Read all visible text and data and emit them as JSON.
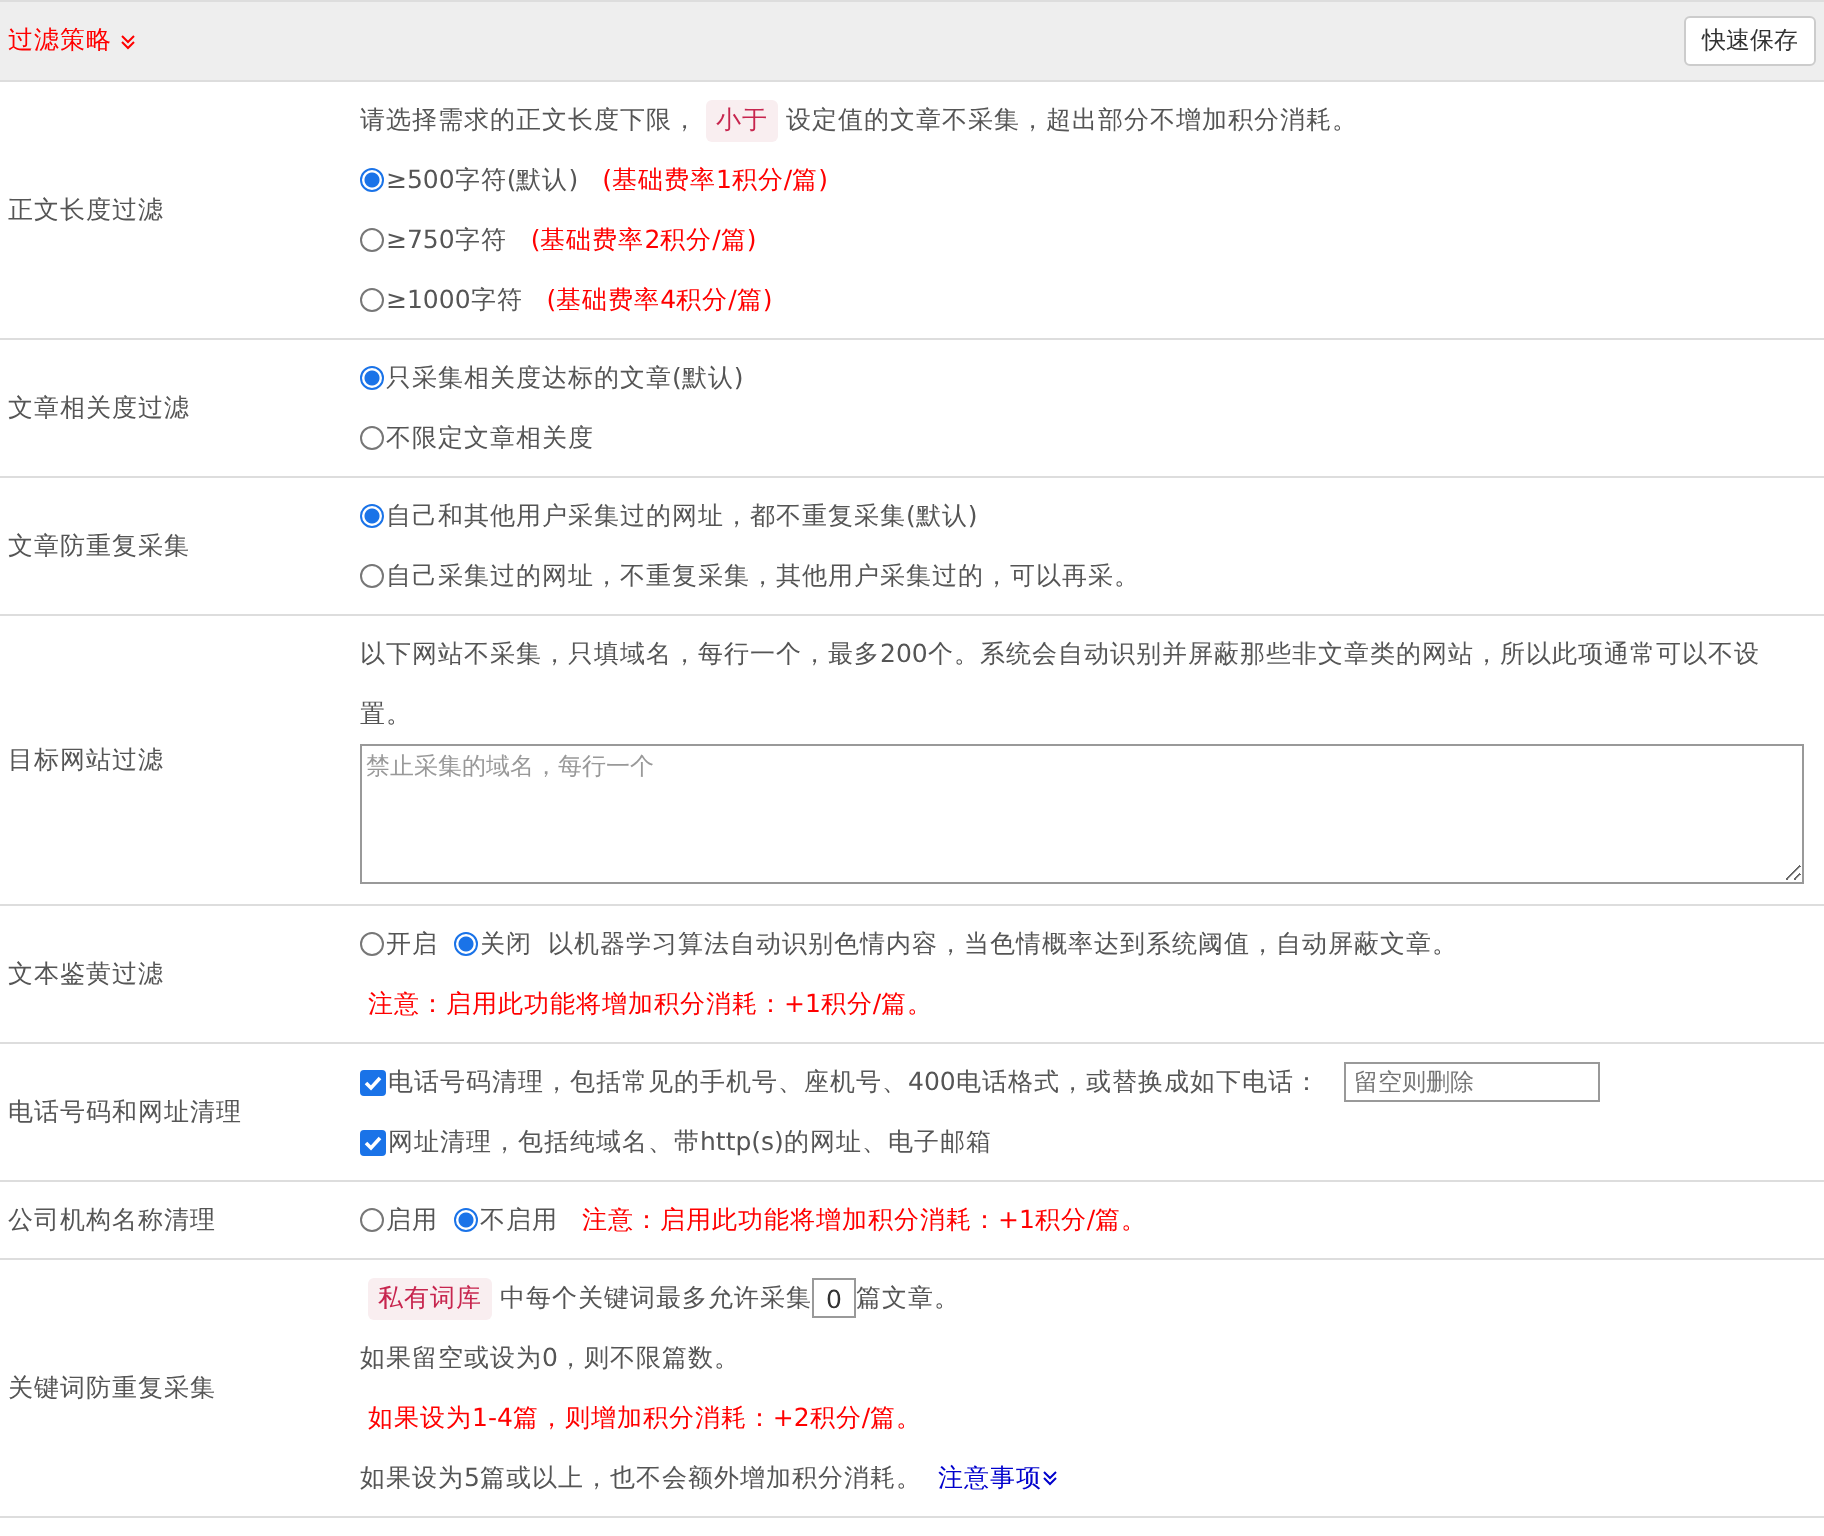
{
  "header": {
    "title": "过滤策略",
    "save_button": "快速保存"
  },
  "rows": [
    {
      "label": "正文长度过滤",
      "lines": [
        [
          {
            "kind": "text",
            "text": "请选择需求的正文长度下限，"
          },
          {
            "kind": "tag",
            "text": "小于"
          },
          {
            "kind": "text",
            "text": "设定值的文章不采集，超出部分不增加积分消耗。"
          }
        ],
        [
          {
            "kind": "radio",
            "text": "≥500字符(默认)",
            "selected": true
          },
          {
            "kind": "note",
            "text": "(基础费率1积分/篇)"
          }
        ],
        [
          {
            "kind": "radio",
            "text": "≥750字符",
            "selected": false
          },
          {
            "kind": "note",
            "text": "(基础费率2积分/篇)"
          }
        ],
        [
          {
            "kind": "radio",
            "text": "≥1000字符",
            "selected": false
          },
          {
            "kind": "note",
            "text": "(基础费率4积分/篇)"
          }
        ]
      ]
    },
    {
      "label": "文章相关度过滤",
      "lines": [
        [
          {
            "kind": "radio",
            "text": "只采集相关度达标的文章(默认)",
            "selected": true
          }
        ],
        [
          {
            "kind": "radio",
            "text": "不限定文章相关度",
            "selected": false
          }
        ]
      ]
    },
    {
      "label": "文章防重复采集",
      "lines": [
        [
          {
            "kind": "radio",
            "text": "自己和其他用户采集过的网址，都不重复采集(默认)",
            "selected": true
          }
        ],
        [
          {
            "kind": "radio",
            "text": "自己采集过的网址，不重复采集，其他用户采集过的，可以再采。",
            "selected": false
          }
        ]
      ]
    },
    {
      "label": "目标网站过滤",
      "lines": [
        [
          {
            "kind": "text",
            "text": "以下网站不采集，只填域名，每行一个，最多200个。系统会自动识别并屏蔽那些非文章类的网站，所以此项通常可以不设置。"
          }
        ],
        [
          {
            "kind": "textarea",
            "placeholder": "禁止采集的域名，每行一个"
          }
        ]
      ]
    },
    {
      "label": "文本鉴黄过滤",
      "lines": [
        [
          {
            "kind": "radio",
            "text": "开启",
            "selected": false
          },
          {
            "kind": "radio",
            "text": "关闭",
            "selected": true
          },
          {
            "kind": "text",
            "text": "以机器学习算法自动识别色情内容，当色情概率达到系统阈值，自动屏蔽文章。"
          }
        ],
        [
          {
            "kind": "note",
            "text": "注意：启用此功能将增加积分消耗：+1积分/篇。"
          }
        ]
      ]
    },
    {
      "label": "电话号码和网址清理",
      "lines": [
        [
          {
            "kind": "checkbox",
            "text": "电话号码清理，包括常见的手机号、座机号、400电话格式，或替换成如下电话：",
            "checked": true
          },
          {
            "kind": "input",
            "placeholder": "留空则删除"
          }
        ],
        [
          {
            "kind": "checkbox",
            "text": "网址清理，包括纯域名、带http(s)的网址、电子邮箱",
            "checked": true
          }
        ]
      ]
    },
    {
      "label": "公司机构名称清理",
      "lines": [
        [
          {
            "kind": "radio",
            "text": "启用",
            "selected": false
          },
          {
            "kind": "radio",
            "text": "不启用",
            "selected": true
          },
          {
            "kind": "note",
            "text": "注意：启用此功能将增加积分消耗：+1积分/篇。"
          }
        ]
      ]
    },
    {
      "label": "关键词防重复采集",
      "lines": [
        [
          {
            "kind": "tag",
            "text": "私有词库"
          },
          {
            "kind": "text",
            "text": "中每个关键词最多允许采集"
          },
          {
            "kind": "number",
            "value": "0"
          },
          {
            "kind": "text",
            "text": "篇文章。"
          }
        ],
        [
          {
            "kind": "text",
            "text": "如果留空或设为0，则不限篇数。"
          }
        ],
        [
          {
            "kind": "note",
            "text": "如果设为1-4篇，则增加积分消耗：+2积分/篇。"
          }
        ],
        [
          {
            "kind": "text",
            "text": "如果设为5篇或以上，也不会额外增加积分消耗。"
          },
          {
            "kind": "link",
            "text": "注意事项"
          }
        ]
      ]
    }
  ]
}
